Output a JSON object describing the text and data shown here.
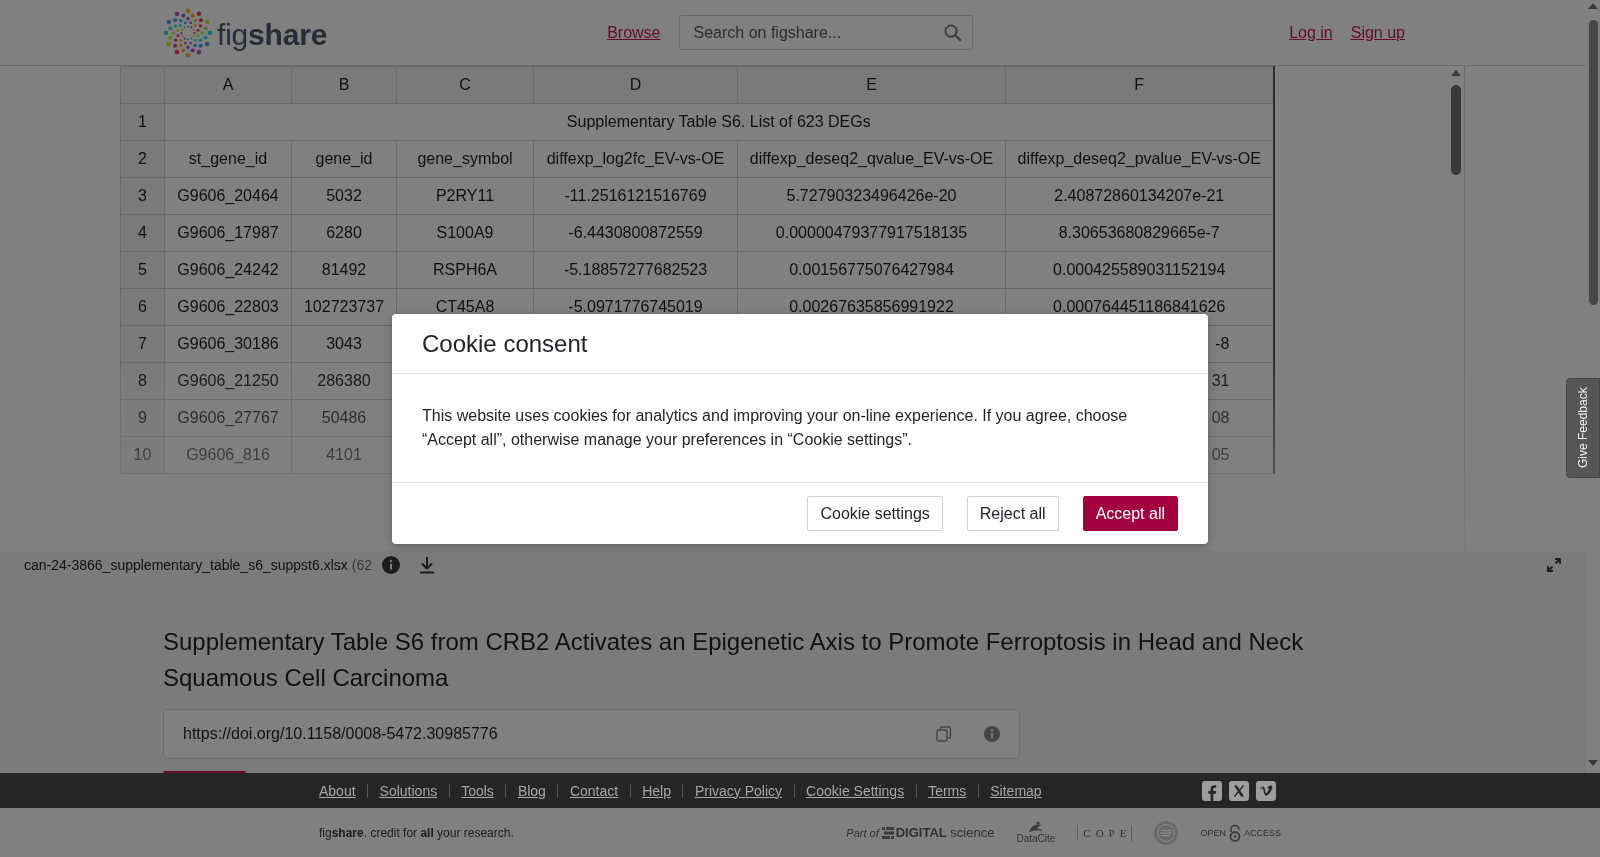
{
  "header": {
    "logo_text": "fig**share**",
    "nav_link": "Browse",
    "search": {
      "placeholder": "Search on figshare..."
    },
    "auth_links": [
      "Log in",
      "Sign up"
    ]
  },
  "spreadsheet": {
    "columns": [
      "A",
      "B",
      "C",
      "D",
      "E",
      "F"
    ],
    "rows": [
      {
        "number": "1",
        "title": "Supplementary Table S6. List of 623 DEGs"
      },
      {
        "number": "2",
        "cells": [
          "st_gene_id",
          "gene_id",
          "gene_symbol",
          "diffexp_log2fc_EV-vs-OE",
          "diffexp_deseq2_qvalue_EV-vs-OE",
          "diffexp_deseq2_pvalue_EV-vs-OE"
        ]
      },
      {
        "number": "3",
        "cells": [
          "G9606_20464",
          "5032",
          "P2RY11",
          "-11.2516121516769",
          "5.72790323496426e-20",
          "2.40872860134207e-21"
        ]
      },
      {
        "number": "4",
        "cells": [
          "G9606_17987",
          "6280",
          "S100A9",
          "-6.4430800872559",
          "0.00000479377917518135",
          "8.30653680829665e-7"
        ]
      },
      {
        "number": "5",
        "cells": [
          "G9606_24242",
          "81492",
          "RSPH6A",
          "-5.18857277682523",
          "0.00156775076427984",
          "0.000425589031152194"
        ]
      },
      {
        "number": "6",
        "cells": [
          "G9606_22803",
          "102723737",
          "CT45A8",
          "-5.0971776745019",
          "0.00267635856991922",
          "0.000764451186841626"
        ]
      },
      {
        "number": "7",
        "cells": [
          "G9606_30186",
          "3043"
        ],
        "last_fragment": "-8"
      },
      {
        "number": "8",
        "cells": [
          "G9606_21250",
          "286380"
        ],
        "last_fragment": "31"
      },
      {
        "number": "9",
        "cells": [
          "G9606_27767",
          "50486"
        ],
        "last_fragment": "08"
      },
      {
        "number": "10",
        "cells": [
          "G9606_816",
          "4101"
        ],
        "last_fragment": "05"
      }
    ]
  },
  "file_bar": {
    "file_name": "can-24-3866_supplementary_table_s6_suppst6.xlsx",
    "file_size": "(62"
  },
  "item": {
    "title": "Supplementary Table S6 from CRB2 Activates an Epigenetic Axis to Promote Ferroptosis in Head and Neck Squamous Cell Carcinoma",
    "doi": "https://doi.org/10.1158/0008-5472.30985776"
  },
  "feedback_tab": {
    "label": "Give Feedback"
  },
  "cookie_dialog": {
    "title": "Cookie consent",
    "message": "This website uses cookies for analytics and improving your on-line experience. If you agree, choose “Accept all”, otherwise manage your preferences in “Cookie settings”.",
    "buttons": [
      {
        "label": "Cookie settings",
        "kind": "secondary"
      },
      {
        "label": "Reject all",
        "kind": "secondary"
      },
      {
        "label": "Accept all",
        "kind": "primary"
      }
    ]
  },
  "footer": {
    "links": [
      "About",
      "Solutions",
      "Tools",
      "Blog",
      "Contact",
      "Help",
      "Privacy Policy",
      "Cookie Settings",
      "Terms",
      "Sitemap"
    ],
    "social": [
      {
        "kind": "facebook"
      },
      {
        "kind": "x"
      },
      {
        "kind": "vimeo"
      }
    ],
    "tagline": "fig**share**. credit for **all** your research.",
    "partners": [
      {
        "kind": "digital_science",
        "texts": [
          "Part of",
          "**DIGITAL** science"
        ]
      },
      {
        "kind": "datacite",
        "texts": [
          "DataCite"
        ]
      },
      {
        "kind": "cope",
        "texts": [
          "COPE"
        ]
      },
      {
        "kind": "seal"
      },
      {
        "kind": "open_access",
        "texts": [
          "OPEN",
          "ACCESS"
        ]
      }
    ]
  }
}
